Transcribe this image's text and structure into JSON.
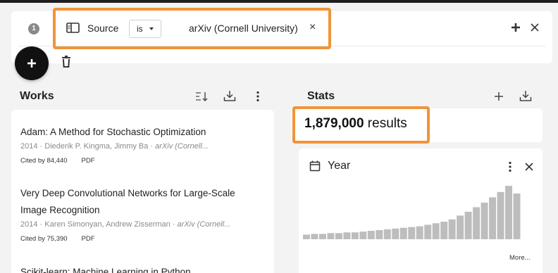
{
  "filter": {
    "step": "1",
    "field_label": "Source",
    "operator": "is",
    "value": "arXiv (Cornell University)",
    "remove_glyph": "×"
  },
  "works": {
    "title": "Works",
    "items": [
      {
        "title_lines": [
          "Adam: A Method for Stochastic Optimization"
        ],
        "meta_prefix": "2014 · Diederik P. Kingma, Jimmy Ba · ",
        "meta_source": "arXiv (Cornell...",
        "cited": "Cited by 84,440",
        "pdf": "PDF"
      },
      {
        "title_lines": [
          "Very Deep Convolutional Networks for Large-Scale",
          "Image Recognition"
        ],
        "meta_prefix": "2014 · Karen Simonyan, Andrew Zisserman · ",
        "meta_source": "arXiv (Cornell...",
        "cited": "Cited by 75,390",
        "pdf": "PDF"
      },
      {
        "title_lines": [
          "Scikit-learn: Machine Learning in Python"
        ],
        "meta_prefix": "",
        "meta_source": "",
        "cited": "",
        "pdf": ""
      }
    ]
  },
  "stats": {
    "title": "Stats",
    "results_count": "1,879,000",
    "results_suffix": " results"
  },
  "year_card": {
    "title": "Year",
    "more_label": "More..."
  },
  "chart_data": {
    "type": "bar",
    "title": "Year",
    "xlabel": "",
    "ylabel": "",
    "values": [
      6,
      7,
      7,
      8,
      8,
      9,
      9,
      10,
      11,
      12,
      13,
      14,
      15,
      16,
      17,
      19,
      21,
      23,
      26,
      31,
      36,
      42,
      48,
      55,
      62,
      70,
      60
    ],
    "ylim": [
      0,
      72
    ],
    "grid": false,
    "color": "#bdbdbd"
  },
  "colors": {
    "highlight": "#f0943a",
    "card": "#ffffff",
    "background": "#f3f3f3",
    "bar": "#bdbdbd"
  },
  "icons": {
    "source": "source-panel-icon",
    "add": "plus-icon",
    "close": "close-icon",
    "delete": "trash-icon",
    "sort": "sort-icon",
    "download": "download-icon",
    "more": "more-vert-icon",
    "calendar": "calendar-icon"
  }
}
